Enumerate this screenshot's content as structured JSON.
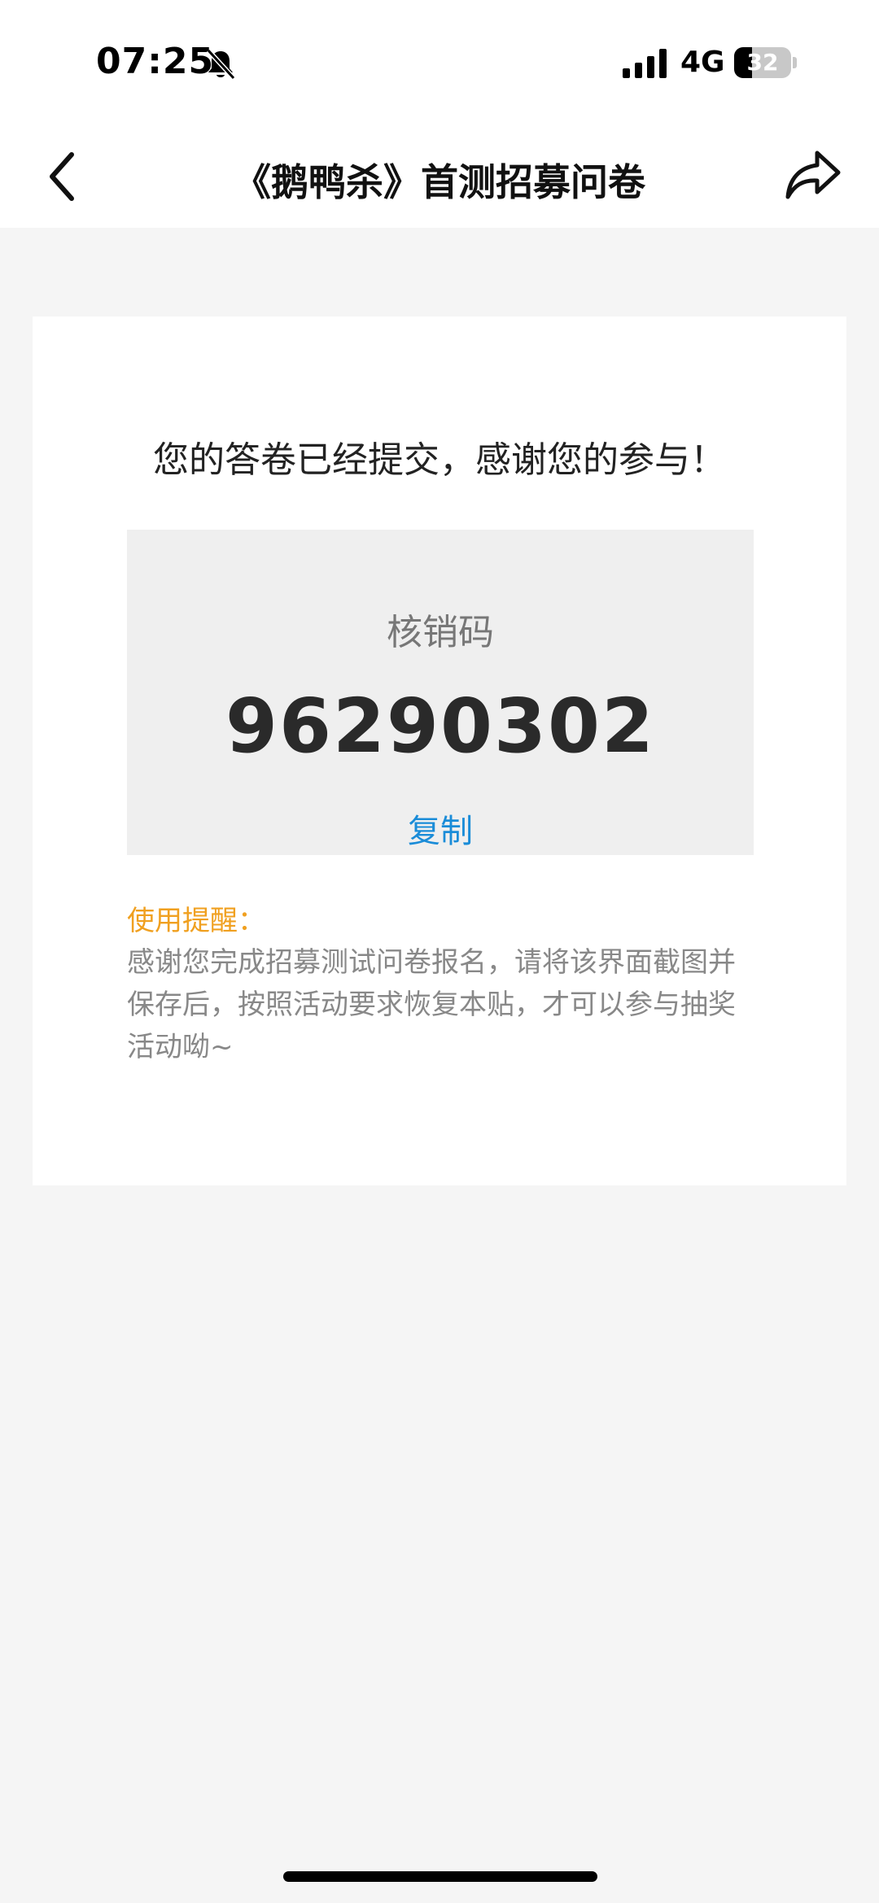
{
  "status_bar": {
    "time": "07:25",
    "network": "4G",
    "battery_level": "32",
    "battery_fraction": 0.32
  },
  "nav": {
    "title": "《鹅鸭杀》首测招募问卷",
    "back_icon": "chevron-left-icon",
    "share_icon": "share-arrow-icon"
  },
  "card": {
    "message": "您的答卷已经提交，感谢您的参与！",
    "code_label": "核销码",
    "code_value": "96290302",
    "copy_label": "复制",
    "reminder_title": "使用提醒：",
    "reminder_text": "感谢您完成招募测试问卷报名，请将该界面截图并保存后，按照活动要求恢复本贴，才可以参与抽奖活动呦~"
  },
  "colors": {
    "accent_blue": "#1a8cd8",
    "reminder_orange": "#f0a020",
    "page_background": "#f5f5f5"
  }
}
